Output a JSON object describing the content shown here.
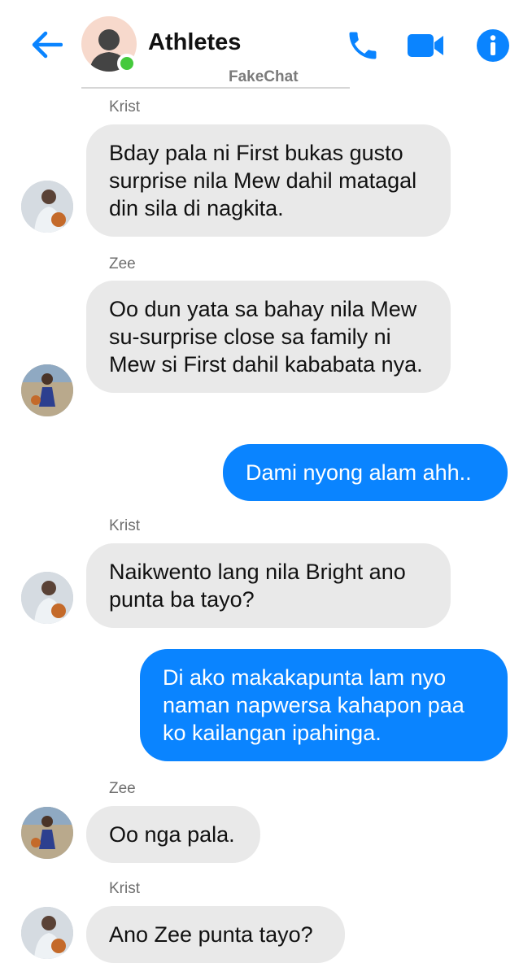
{
  "header": {
    "title": "Athletes",
    "watermark": "FakeChat",
    "icons": {
      "back": "back-arrow-icon",
      "call": "phone-icon",
      "video": "video-camera-icon",
      "info": "info-icon"
    },
    "accent_color": "#0a84ff",
    "online_color": "#44c93b"
  },
  "messages": [
    {
      "sender": "Krist",
      "direction": "incoming",
      "text": "Bday pala ni First bukas gusto surprise nila Mew dahil matagal din sila di nagkita."
    },
    {
      "sender": "Zee",
      "direction": "incoming",
      "text": "Oo dun yata sa bahay nila Mew su-surprise close sa family ni Mew si First dahil kababata nya."
    },
    {
      "sender": "",
      "direction": "outgoing",
      "text": "Dami nyong alam ahh.."
    },
    {
      "sender": "Krist",
      "direction": "incoming",
      "text": "Naikwento lang nila Bright ano punta ba tayo?"
    },
    {
      "sender": "",
      "direction": "outgoing",
      "text": "Di ako makakapunta lam nyo naman napwersa kahapon paa ko kailangan ipahinga."
    },
    {
      "sender": "Zee",
      "direction": "incoming",
      "text": "Oo nga pala."
    },
    {
      "sender": "Krist",
      "direction": "incoming",
      "text": "Ano Zee punta tayo?"
    }
  ]
}
